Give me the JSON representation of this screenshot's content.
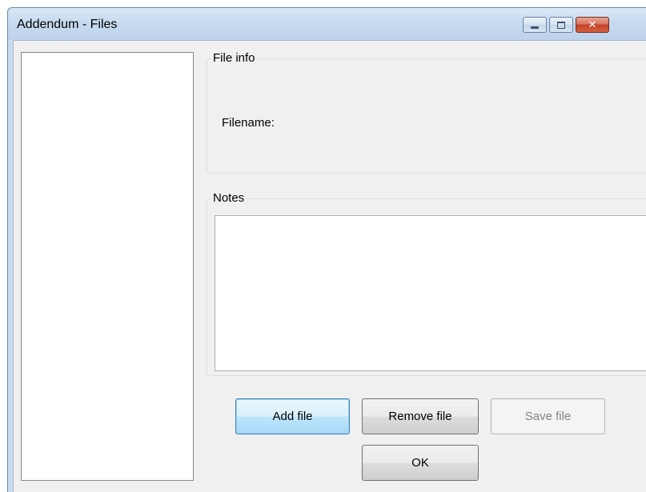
{
  "window": {
    "title": "Addendum - Files",
    "caption_buttons": {
      "minimize_icon": "minimize-icon",
      "maximize_icon": "maximize-icon",
      "close_icon": "close-icon"
    }
  },
  "file_list": {
    "items": []
  },
  "file_info": {
    "group_label": "File info",
    "filename_label": "Filename:"
  },
  "notes": {
    "group_label": "Notes",
    "value": ""
  },
  "buttons": {
    "add_file": "Add file",
    "remove_file": "Remove file",
    "save_file": "Save file",
    "ok": "OK"
  },
  "colors": {
    "titlebar": "#c7daef",
    "client_background": "#f0f0f0",
    "close_button": "#c2412a",
    "focused_button_border": "#3c7fb1"
  }
}
